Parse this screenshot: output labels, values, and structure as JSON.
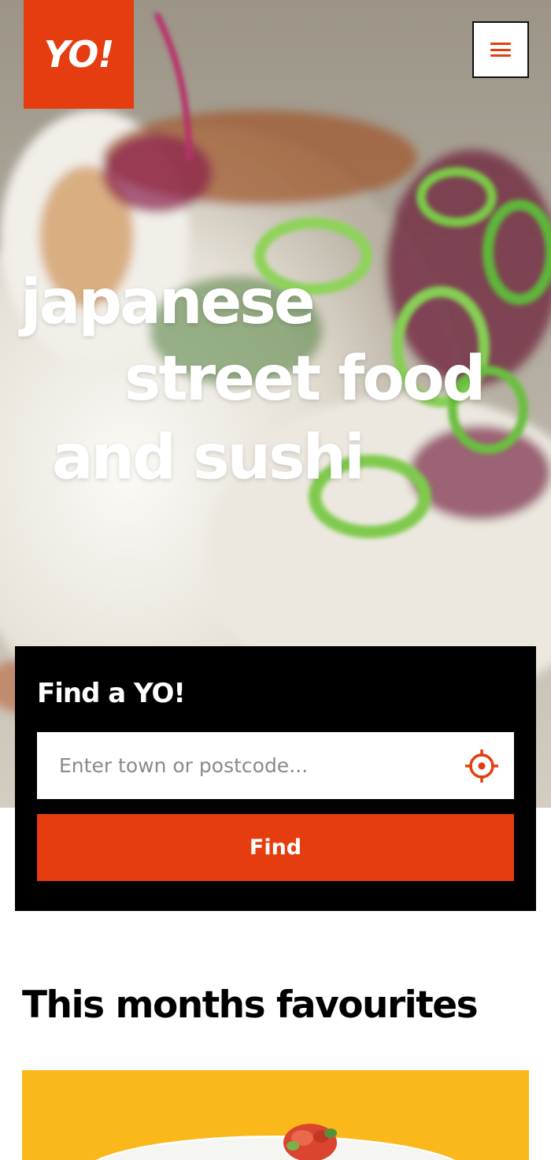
{
  "header": {
    "logo_text": "YO!",
    "menu_icon": "hamburger-icon"
  },
  "hero": {
    "headline": [
      "japanese",
      "street food",
      "and sushi"
    ]
  },
  "finder": {
    "title": "Find a YO!",
    "search_placeholder": "Enter town or postcode...",
    "search_value": "",
    "locate_icon": "crosshair-location-icon",
    "find_label": "Find"
  },
  "favourites": {
    "title": "This months favourites"
  },
  "colors": {
    "brand": "#e53d0f",
    "finder_bg": "#000000",
    "card_bg": "#fbb81a"
  }
}
